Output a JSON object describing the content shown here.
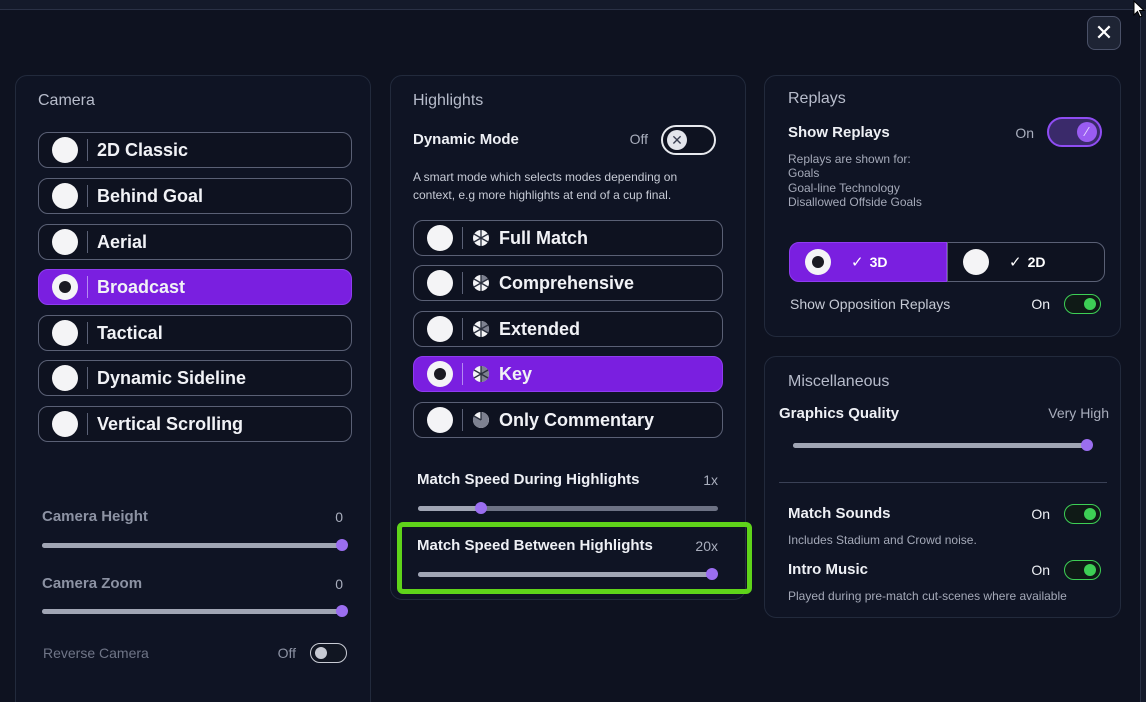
{
  "close_button": {
    "label": "✕"
  },
  "camera": {
    "title": "Camera",
    "options": [
      {
        "label": "2D Classic",
        "selected": false
      },
      {
        "label": "Behind Goal",
        "selected": false
      },
      {
        "label": "Aerial",
        "selected": false
      },
      {
        "label": "Broadcast",
        "selected": true
      },
      {
        "label": "Tactical",
        "selected": false
      },
      {
        "label": "Dynamic Sideline",
        "selected": false
      },
      {
        "label": "Vertical Scrolling",
        "selected": false
      }
    ],
    "height": {
      "label": "Camera Height",
      "value": "0",
      "level": 1.0
    },
    "zoom": {
      "label": "Camera Zoom",
      "value": "0",
      "level": 1.0
    },
    "reverse": {
      "label": "Reverse Camera",
      "value": "Off"
    }
  },
  "highlights": {
    "title": "Highlights",
    "dynamic_mode": {
      "label": "Dynamic Mode",
      "value": "Off",
      "description": "A smart mode which selects modes depending on context, e.g more highlights at end of a cup final."
    },
    "options": [
      {
        "label": "Full Match",
        "selected": false,
        "icon": "pie-full-icon"
      },
      {
        "label": "Comprehensive",
        "selected": false,
        "icon": "pie-comprehensive-icon"
      },
      {
        "label": "Extended",
        "selected": false,
        "icon": "pie-extended-icon"
      },
      {
        "label": "Key",
        "selected": true,
        "icon": "pie-key-icon"
      },
      {
        "label": "Only Commentary",
        "selected": false,
        "icon": "pie-commentary-icon"
      }
    ],
    "speed_during": {
      "label": "Match Speed During Highlights",
      "value": "1x",
      "level": 0.21
    },
    "speed_between": {
      "label": "Match Speed Between Highlights",
      "value": "20x",
      "level": 1.0
    }
  },
  "replays": {
    "title": "Replays",
    "show": {
      "label": "Show Replays",
      "value": "On"
    },
    "shown_for_heading": "Replays are shown for:",
    "shown_for": [
      "Goals",
      "Goal-line Technology",
      "Disallowed Offside Goals"
    ],
    "mode_3d": {
      "label": "3D",
      "check": "✓",
      "selected": true
    },
    "mode_2d": {
      "label": "2D",
      "check": "✓",
      "selected": false
    },
    "opposition": {
      "label": "Show Opposition Replays",
      "value": "On"
    }
  },
  "misc": {
    "title": "Miscellaneous",
    "graphics": {
      "label": "Graphics Quality",
      "value": "Very High",
      "level": 1.0
    },
    "sounds": {
      "label": "Match Sounds",
      "value": "On",
      "description": "Includes Stadium and Crowd noise."
    },
    "intro": {
      "label": "Intro Music",
      "value": "On",
      "description": "Played during pre-match cut-scenes where available"
    }
  },
  "colors": {
    "accent": "#7a1fe0",
    "toggle_on": "#3dcf55",
    "highlight_frame": "#5fd31a"
  }
}
